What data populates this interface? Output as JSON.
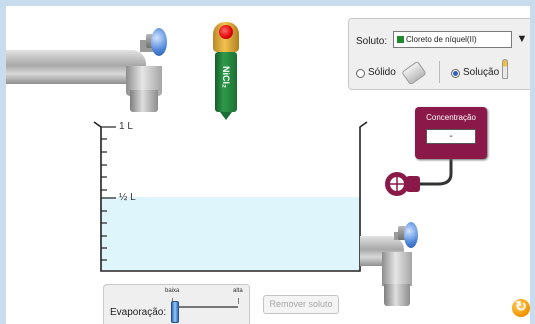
{
  "beaker": {
    "mark_top": "1 L",
    "mark_half": "½ L"
  },
  "dropper": {
    "formula": "NiCl₂"
  },
  "solute_panel": {
    "solute_label": "Soluto:",
    "selected_solute": "Cloreto de níquel(II)",
    "solute_color": "#1e8a2e",
    "dropdown_icon": "▼",
    "solid_label": "Sólido",
    "solution_label": "Solução",
    "selected_form": "Solução"
  },
  "meter": {
    "title": "Concentração",
    "value": "-"
  },
  "evaporation": {
    "label": "Evaporação:",
    "low_label": "baixa",
    "high_label": "alta",
    "level": 0
  },
  "remove_button": {
    "label": "Remover soluto"
  },
  "colors": {
    "liquid": "#def5fb",
    "meter": "#8a1848",
    "faucet_handle": "#4f86d9",
    "frame": "#c9dced"
  }
}
